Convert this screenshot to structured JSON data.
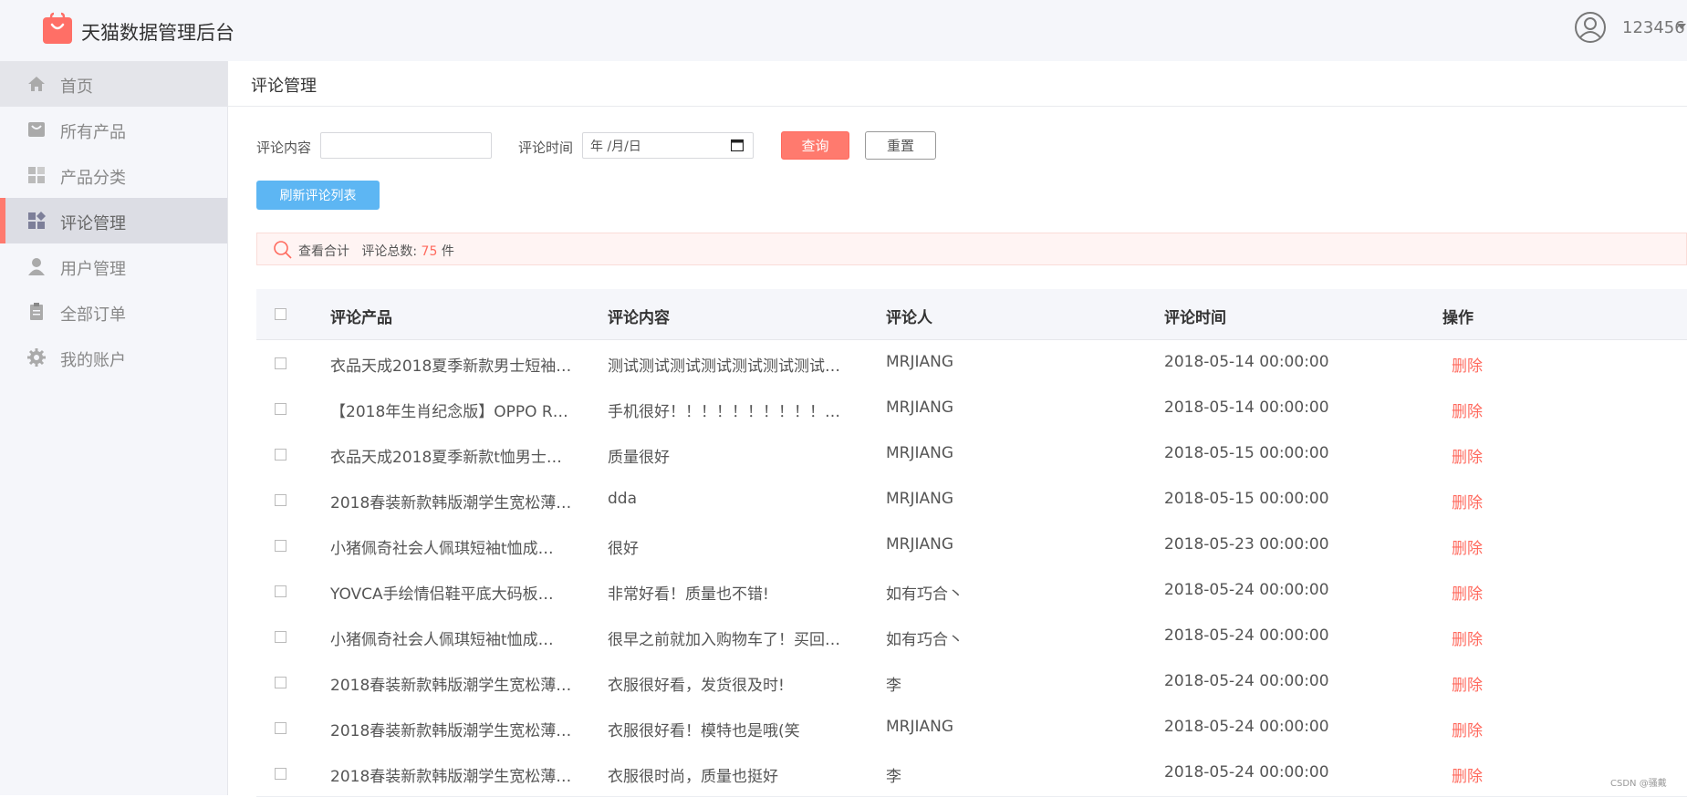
{
  "app": {
    "title": "天猫数据管理后台",
    "user": "123456"
  },
  "sidebar": {
    "items": [
      {
        "label": "首页",
        "icon": "home-icon"
      },
      {
        "label": "所有产品",
        "icon": "product-icon"
      },
      {
        "label": "产品分类",
        "icon": "category-icon"
      },
      {
        "label": "评论管理",
        "icon": "review-icon",
        "active": true
      },
      {
        "label": "用户管理",
        "icon": "user-icon"
      },
      {
        "label": "全部订单",
        "icon": "order-icon"
      },
      {
        "label": "我的账户",
        "icon": "gear-icon"
      }
    ]
  },
  "page": {
    "title": "评论管理"
  },
  "filters": {
    "content_label": "评论内容",
    "content_value": "",
    "time_label": "评论时间",
    "date_placeholder": "年 /月/日",
    "query_label": "查询",
    "reset_label": "重置",
    "refresh_label": "刷新评论列表"
  },
  "summary": {
    "label": "查看合计",
    "total_label": "评论总数:",
    "total": "75",
    "unit": "件"
  },
  "table": {
    "headers": [
      "评论产品",
      "评论内容",
      "评论人",
      "评论时间",
      "操作"
    ],
    "delete_label": "删除",
    "rows": [
      {
        "product": "衣品天成2018夏季新款男士短袖…",
        "content": "测试测试测试测试测试测试测试…",
        "user": "MRJIANG",
        "time": "2018-05-14 00:00:00"
      },
      {
        "product": "【2018年生肖纪念版】OPPO R…",
        "content": "手机很好！！！！！！！！！！…",
        "user": "MRJIANG",
        "time": "2018-05-14 00:00:00"
      },
      {
        "product": "衣品天成2018夏季新款t恤男士…",
        "content": "质量很好",
        "user": "MRJIANG",
        "time": "2018-05-15 00:00:00"
      },
      {
        "product": "2018春装新款韩版潮学生宽松薄…",
        "content": "dda",
        "user": "MRJIANG",
        "time": "2018-05-15 00:00:00"
      },
      {
        "product": "小猪佩奇社会人佩琪短袖t恤成…",
        "content": "很好",
        "user": "MRJIANG",
        "time": "2018-05-23 00:00:00"
      },
      {
        "product": "YOVCA手绘情侣鞋平底大码板…",
        "content": "非常好看！质量也不错!",
        "user": "如有巧合丶",
        "time": "2018-05-24 00:00:00"
      },
      {
        "product": "小猪佩奇社会人佩琪短袖t恤成…",
        "content": "很早之前就加入购物车了！买回…",
        "user": "如有巧合丶",
        "time": "2018-05-24 00:00:00"
      },
      {
        "product": "2018春装新款韩版潮学生宽松薄…",
        "content": "衣服很好看，发货很及时!",
        "user": "李",
        "time": "2018-05-24 00:00:00"
      },
      {
        "product": "2018春装新款韩版潮学生宽松薄…",
        "content": "衣服很好看！模特也是哦(笑",
        "user": "MRJIANG",
        "time": "2018-05-24 00:00:00"
      },
      {
        "product": "2018春装新款韩版潮学生宽松薄…",
        "content": "衣服很时尚，质量也挺好",
        "user": "李",
        "time": "2018-05-24 00:00:00"
      }
    ]
  },
  "watermark": "CSDN @骚戴",
  "colors": {
    "accent": "#ff7a6e",
    "refresh": "#5db6f3",
    "sidebar_bg": "#f5f6fa"
  }
}
